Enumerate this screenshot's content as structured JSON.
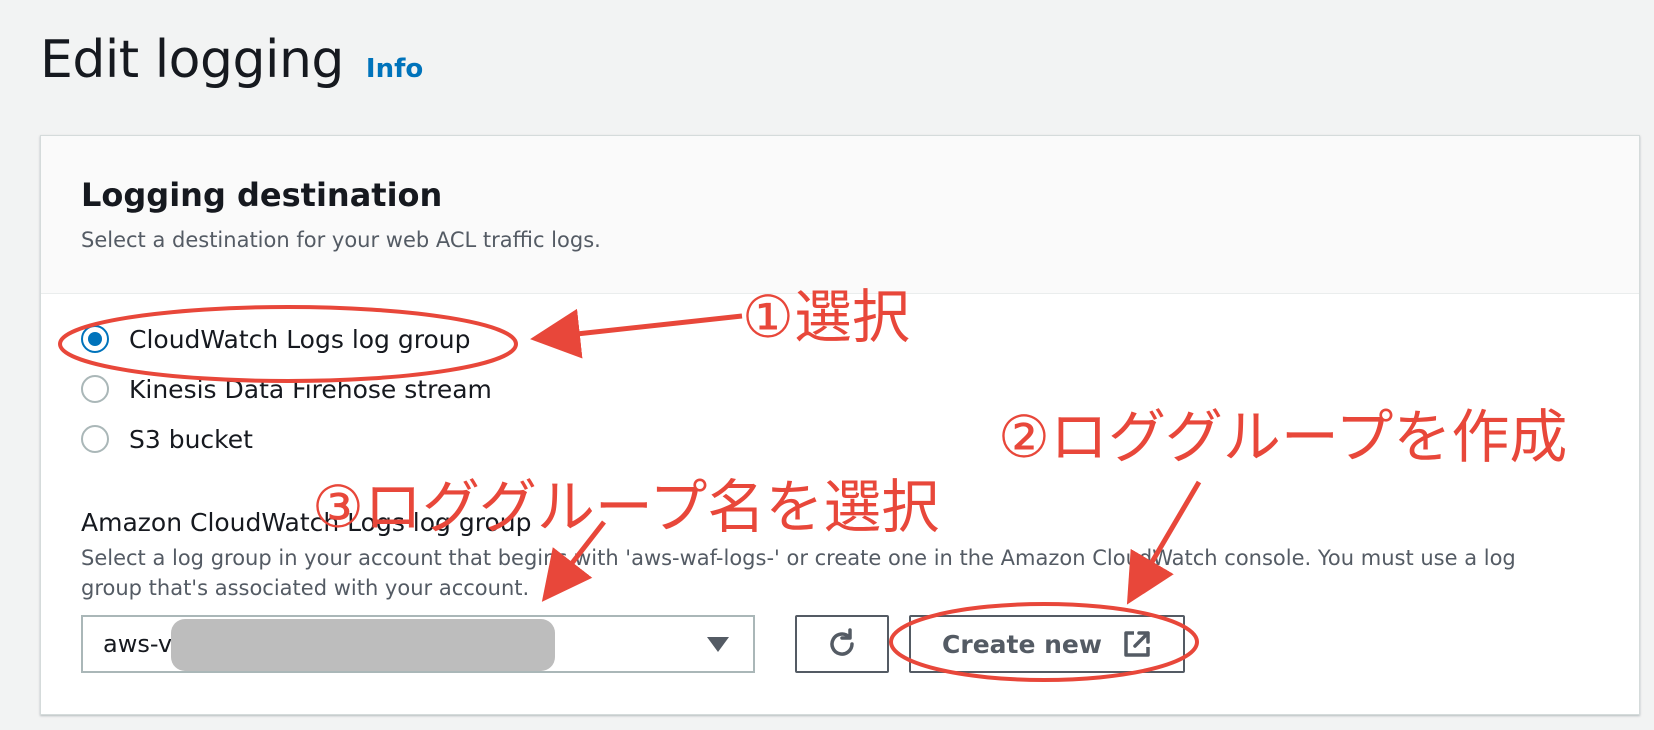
{
  "header": {
    "title": "Edit logging",
    "info_link": "Info"
  },
  "panel": {
    "title": "Logging destination",
    "description": "Select a destination for your web ACL traffic logs."
  },
  "destinations": [
    {
      "label": "CloudWatch Logs log group",
      "checked": true
    },
    {
      "label": "Kinesis Data Firehose stream",
      "checked": false
    },
    {
      "label": "S3 bucket",
      "checked": false
    }
  ],
  "log_group_field": {
    "label": "Amazon CloudWatch Logs log group",
    "description": "Select a log group in your account that begins with 'aws-waf-logs-' or create one in the Amazon CloudWatch console. You must use a log group that's associated with your account.",
    "selected_value": "aws-v",
    "create_button_label": "Create new"
  },
  "annotations": {
    "step1": "①選択",
    "step2": "②ロググループを作成",
    "step3": "③ロググループ名を選択",
    "color": "#e8473a"
  },
  "icons": {
    "refresh": "refresh-icon",
    "external_link": "external-link-icon",
    "dropdown": "caret-down-icon"
  }
}
